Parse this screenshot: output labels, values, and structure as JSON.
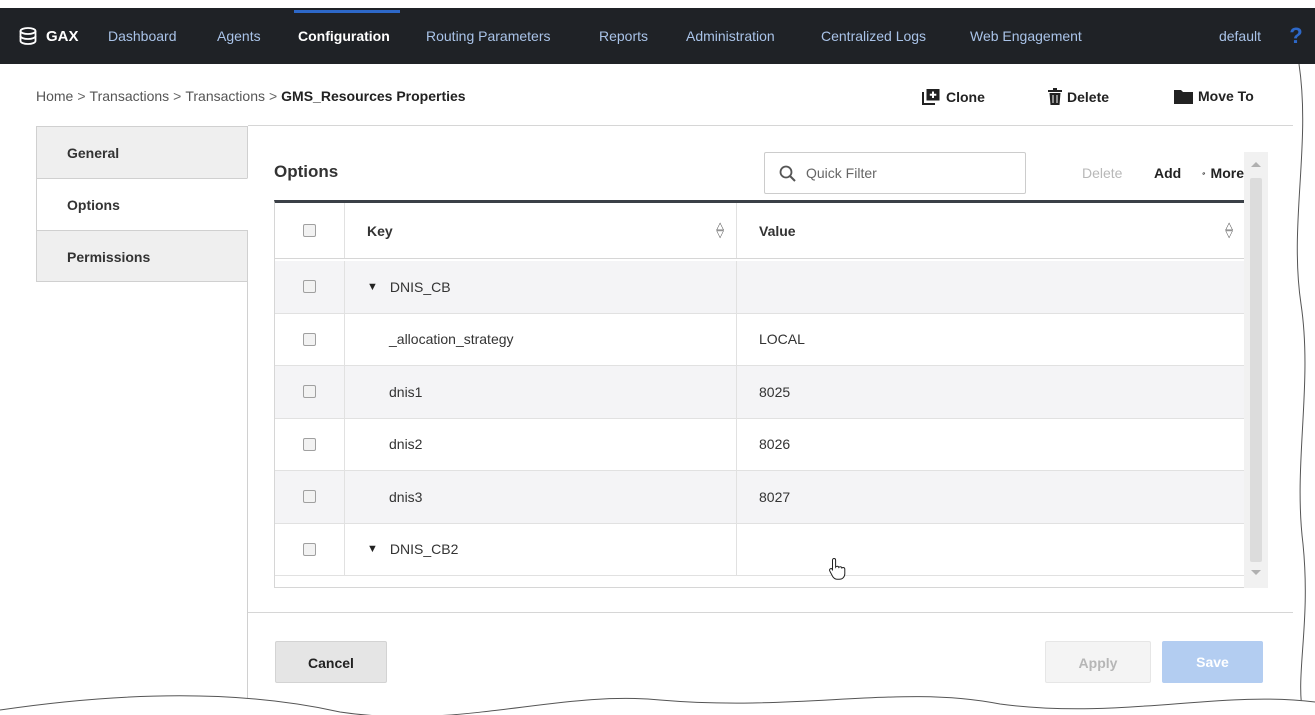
{
  "navbar": {
    "brand": "GAX",
    "items": [
      {
        "label": "Dashboard",
        "active": false
      },
      {
        "label": "Agents",
        "active": false
      },
      {
        "label": "Configuration",
        "active": true
      },
      {
        "label": "Routing Parameters",
        "active": false
      },
      {
        "label": "Reports",
        "active": false
      },
      {
        "label": "Administration",
        "active": false
      },
      {
        "label": "Centralized Logs",
        "active": false
      },
      {
        "label": "Web Engagement",
        "active": false
      }
    ],
    "user": "default",
    "help": "?"
  },
  "breadcrumb": {
    "items": [
      "Home",
      "Transactions",
      "Transactions"
    ],
    "separator": ">",
    "current": "GMS_Resources Properties"
  },
  "actions": {
    "clone": "Clone",
    "delete": "Delete",
    "move_to": "Move To"
  },
  "tabs": [
    {
      "label": "General",
      "active": false
    },
    {
      "label": "Options",
      "active": true
    },
    {
      "label": "Permissions",
      "active": false
    }
  ],
  "options": {
    "title": "Options",
    "quick_filter_placeholder": "Quick Filter",
    "delete_label": "Delete",
    "add_label": "Add",
    "more_label": "More"
  },
  "grid": {
    "columns": {
      "key": "Key",
      "value": "Value"
    },
    "rows": [
      {
        "key": "DNIS_CB",
        "value": "",
        "section": true
      },
      {
        "key": "_allocation_strategy",
        "value": "LOCAL",
        "section": false
      },
      {
        "key": "dnis1",
        "value": "8025",
        "section": false
      },
      {
        "key": "dnis2",
        "value": "8026",
        "section": false
      },
      {
        "key": "dnis3",
        "value": "8027",
        "section": false
      },
      {
        "key": "DNIS_CB2",
        "value": "",
        "section": true
      }
    ]
  },
  "footer": {
    "cancel": "Cancel",
    "apply": "Apply",
    "save": "Save"
  },
  "colors": {
    "navbar_bg": "#1f2226",
    "nav_link": "#a9c3e8",
    "accent": "#2d68c8",
    "save_disabled": "#b3cdf1"
  }
}
